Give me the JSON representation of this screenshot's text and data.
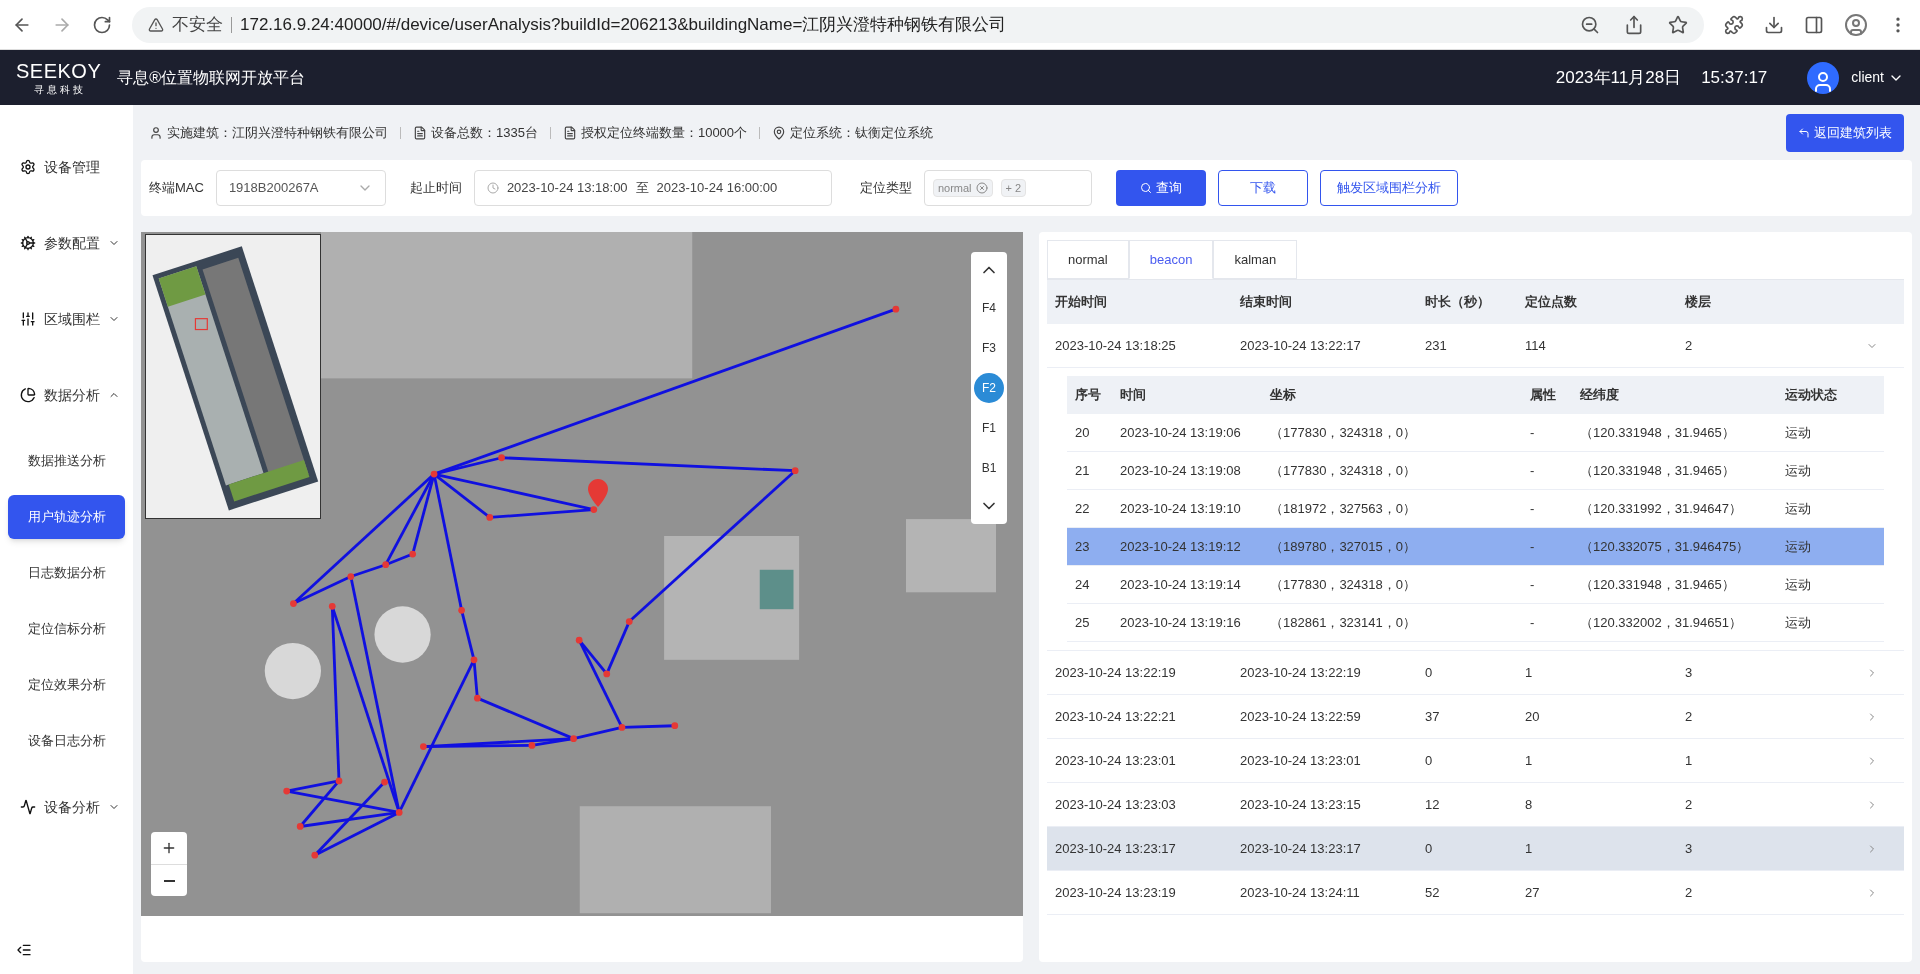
{
  "browser": {
    "security": "不安全",
    "url": "172.16.9.24:40000/#/device/userAnalysis?buildId=206213&buildingName=江阴兴澄特种钢铁有限公司"
  },
  "header": {
    "logo": "SEEKOY",
    "logo_sub": "寻 息 科 技",
    "title": "寻息®位置物联网开放平台",
    "date": "2023年11月28日",
    "time": "15:37:17",
    "user": "client"
  },
  "sidebar": {
    "items": [
      {
        "label": "设备管理",
        "kind": "link"
      },
      {
        "label": "参数配置",
        "kind": "menu",
        "expanded": false
      },
      {
        "label": "区域围栏",
        "kind": "menu",
        "expanded": false
      },
      {
        "label": "数据分析",
        "kind": "menu",
        "expanded": true,
        "children": [
          {
            "label": "数据推送分析",
            "selected": false
          },
          {
            "label": "用户轨迹分析",
            "selected": true
          },
          {
            "label": "日志数据分析",
            "selected": false
          },
          {
            "label": "定位信标分析",
            "selected": false
          },
          {
            "label": "定位效果分析",
            "selected": false
          },
          {
            "label": "设备日志分析",
            "selected": false
          }
        ]
      },
      {
        "label": "设备分析",
        "kind": "menu",
        "expanded": false
      }
    ]
  },
  "info_bar": {
    "items": [
      "实施建筑：江阴兴澄特种钢铁有限公司",
      "设备总数：1335台",
      "授权定位终端数量：10000个",
      "定位系统：钛衡定位系统"
    ],
    "back_button": "返回建筑列表"
  },
  "filters": {
    "mac": {
      "label": "终端MAC",
      "value": "1918B200267A"
    },
    "time": {
      "label": "起止时间",
      "start": "2023-10-24 13:18:00",
      "separator": "至",
      "end": "2023-10-24 16:00:00"
    },
    "type": {
      "label": "定位类型",
      "tags": [
        "normal"
      ],
      "more": "+ 2"
    },
    "buttons": [
      {
        "label": "查询",
        "kind": "primary"
      },
      {
        "label": "下载",
        "kind": "outline"
      },
      {
        "label": "触发区域围栏分析",
        "kind": "outline"
      }
    ]
  },
  "map": {
    "floors": [
      {
        "label": "F4",
        "selected": false
      },
      {
        "label": "F3",
        "selected": false
      },
      {
        "label": "F2",
        "selected": true
      },
      {
        "label": "F1",
        "selected": false
      },
      {
        "label": "B1",
        "selected": false
      }
    ]
  },
  "tabs": [
    {
      "label": "normal",
      "selected": false
    },
    {
      "label": "beacon",
      "selected": true
    },
    {
      "label": "kalman",
      "selected": false
    }
  ],
  "table": {
    "columns": [
      "开始时间",
      "结束时间",
      "时长（秒）",
      "定位点数",
      "楼层"
    ],
    "rows": [
      {
        "cells": [
          "2023-10-24 13:18:25",
          "2023-10-24 13:22:17",
          "231",
          "114",
          "2"
        ],
        "expanded": true,
        "hovered": false,
        "detail": {
          "columns": [
            "序号",
            "时间",
            "坐标",
            "属性",
            "经纬度",
            "运动状态"
          ],
          "rows": [
            {
              "cells": [
                "20",
                "2023-10-24 13:19:06",
                "（177830，324318，0）",
                "-",
                "（120.331948，31.9465）",
                "运动"
              ],
              "selected": false
            },
            {
              "cells": [
                "21",
                "2023-10-24 13:19:08",
                "（177830，324318，0）",
                "-",
                "（120.331948，31.9465）",
                "运动"
              ],
              "selected": false
            },
            {
              "cells": [
                "22",
                "2023-10-24 13:19:10",
                "（181972，327563，0）",
                "-",
                "（120.331992，31.94647）",
                "运动"
              ],
              "selected": false
            },
            {
              "cells": [
                "23",
                "2023-10-24 13:19:12",
                "（189780，327015，0）",
                "-",
                "（120.332075，31.946475）",
                "运动"
              ],
              "selected": true
            },
            {
              "cells": [
                "24",
                "2023-10-24 13:19:14",
                "（177830，324318，0）",
                "-",
                "（120.331948，31.9465）",
                "运动"
              ],
              "selected": false
            },
            {
              "cells": [
                "25",
                "2023-10-24 13:19:16",
                "（182861，323141，0）",
                "-",
                "（120.332002，31.94651）",
                "运动"
              ],
              "selected": false
            }
          ]
        }
      },
      {
        "cells": [
          "2023-10-24 13:22:19",
          "2023-10-24 13:22:19",
          "0",
          "1",
          "3"
        ],
        "expanded": false,
        "hovered": false
      },
      {
        "cells": [
          "2023-10-24 13:22:21",
          "2023-10-24 13:22:59",
          "37",
          "20",
          "2"
        ],
        "expanded": false,
        "hovered": false
      },
      {
        "cells": [
          "2023-10-24 13:23:01",
          "2023-10-24 13:23:01",
          "0",
          "1",
          "1"
        ],
        "expanded": false,
        "hovered": false
      },
      {
        "cells": [
          "2023-10-24 13:23:03",
          "2023-10-24 13:23:15",
          "12",
          "8",
          "2"
        ],
        "expanded": false,
        "hovered": false
      },
      {
        "cells": [
          "2023-10-24 13:23:17",
          "2023-10-24 13:23:17",
          "0",
          "1",
          "3"
        ],
        "expanded": false,
        "hovered": true
      },
      {
        "cells": [
          "2023-10-24 13:23:19",
          "2023-10-24 13:24:11",
          "52",
          "27",
          "2"
        ],
        "expanded": false,
        "hovered": false
      }
    ]
  }
}
